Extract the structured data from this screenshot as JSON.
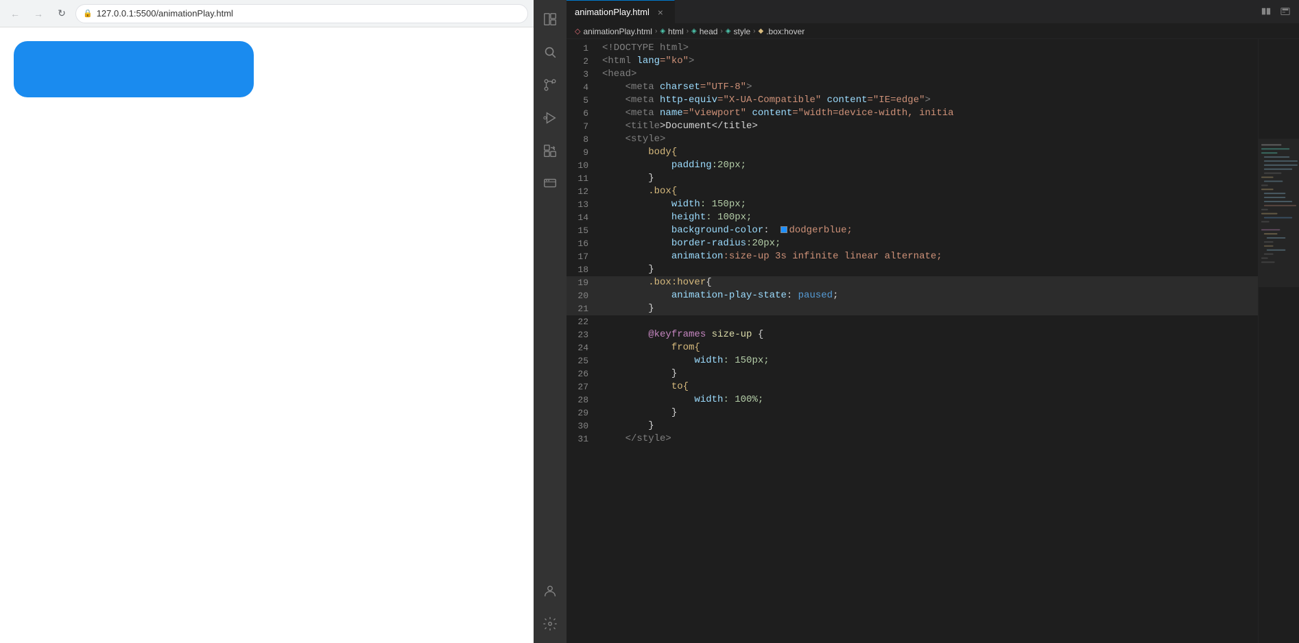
{
  "browser": {
    "url": "127.0.0.1:5500/animationPlay.html",
    "back_disabled": true,
    "forward_disabled": true
  },
  "vscode": {
    "tab": {
      "filename": "animationPlay.html",
      "close_symbol": "×"
    },
    "tab_actions": [
      "⊡",
      "⊞"
    ],
    "breadcrumb": {
      "items": [
        {
          "label": "animationPlay.html",
          "icon": "◇"
        },
        {
          "label": "html",
          "icon": "◈"
        },
        {
          "label": "head",
          "icon": "◈"
        },
        {
          "label": "style",
          "icon": "◈"
        },
        {
          "label": ".box:hover",
          "icon": "◆"
        }
      ]
    },
    "lines": [
      {
        "num": 1,
        "tokens": [
          {
            "t": "<!DOCTYPE html>",
            "c": "kw-doctype"
          }
        ]
      },
      {
        "num": 2,
        "tokens": [
          {
            "t": "<html",
            "c": "tag-bracket"
          },
          {
            "t": " lang",
            "c": "attr-name"
          },
          {
            "t": "=\"ko\"",
            "c": "attr-value"
          },
          {
            "t": ">",
            "c": "tag-bracket"
          }
        ]
      },
      {
        "num": 3,
        "tokens": [
          {
            "t": "<head>",
            "c": "tag-bracket"
          }
        ]
      },
      {
        "num": 4,
        "tokens": [
          {
            "t": "    ",
            "c": ""
          },
          {
            "t": "<meta",
            "c": "tag-bracket"
          },
          {
            "t": " charset",
            "c": "attr-name"
          },
          {
            "t": "=\"UTF-8\"",
            "c": "attr-value"
          },
          {
            "t": ">",
            "c": "tag-bracket"
          }
        ]
      },
      {
        "num": 5,
        "tokens": [
          {
            "t": "    ",
            "c": ""
          },
          {
            "t": "<meta",
            "c": "tag-bracket"
          },
          {
            "t": " http-equiv",
            "c": "attr-name"
          },
          {
            "t": "=\"X-UA-Compatible\"",
            "c": "attr-value"
          },
          {
            "t": " content",
            "c": "attr-name"
          },
          {
            "t": "=\"IE=edge\"",
            "c": "attr-value"
          },
          {
            "t": ">",
            "c": "tag-bracket"
          }
        ]
      },
      {
        "num": 6,
        "tokens": [
          {
            "t": "    ",
            "c": ""
          },
          {
            "t": "<meta",
            "c": "tag-bracket"
          },
          {
            "t": " name",
            "c": "attr-name"
          },
          {
            "t": "=\"viewport\"",
            "c": "attr-value"
          },
          {
            "t": " content",
            "c": "attr-name"
          },
          {
            "t": "=\"width=device-width, initia",
            "c": "attr-value"
          }
        ]
      },
      {
        "num": 7,
        "tokens": [
          {
            "t": "    ",
            "c": ""
          },
          {
            "t": "<title",
            "c": "tag-bracket"
          },
          {
            "t": ">Document</title>",
            "c": "punct"
          }
        ]
      },
      {
        "num": 8,
        "tokens": [
          {
            "t": "    ",
            "c": ""
          },
          {
            "t": "<style>",
            "c": "tag-bracket"
          }
        ]
      },
      {
        "num": 9,
        "tokens": [
          {
            "t": "        body{",
            "c": "kw-selector"
          }
        ]
      },
      {
        "num": 10,
        "tokens": [
          {
            "t": "            padding",
            "c": "kw-property"
          },
          {
            "t": ":20px;",
            "c": "kw-value-num"
          }
        ]
      },
      {
        "num": 11,
        "tokens": [
          {
            "t": "        }",
            "c": "punct"
          }
        ]
      },
      {
        "num": 12,
        "tokens": [
          {
            "t": "        .box{",
            "c": "kw-selector"
          }
        ]
      },
      {
        "num": 13,
        "tokens": [
          {
            "t": "            width",
            "c": "kw-property"
          },
          {
            "t": ": 150px;",
            "c": "kw-value-num"
          }
        ]
      },
      {
        "num": 14,
        "tokens": [
          {
            "t": "            height",
            "c": "kw-property"
          },
          {
            "t": ": 100px;",
            "c": "kw-value-num"
          }
        ]
      },
      {
        "num": 15,
        "tokens": [
          {
            "t": "            background-color",
            "c": "kw-property"
          },
          {
            "t": ":  ",
            "c": "punct"
          },
          {
            "t": "SWATCH",
            "c": "swatch"
          },
          {
            "t": "dodgerblue;",
            "c": "kw-value"
          }
        ]
      },
      {
        "num": 16,
        "tokens": [
          {
            "t": "            border-radius",
            "c": "kw-property"
          },
          {
            "t": ":20px;",
            "c": "kw-value-num"
          }
        ]
      },
      {
        "num": 17,
        "tokens": [
          {
            "t": "            animation",
            "c": "kw-property"
          },
          {
            "t": ":size-up 3s infinite linear alternate;",
            "c": "kw-value"
          }
        ]
      },
      {
        "num": 18,
        "tokens": [
          {
            "t": "        }",
            "c": "punct"
          }
        ]
      },
      {
        "num": 19,
        "tokens": [
          {
            "t": "        .box:hover",
            "c": "kw-selector"
          },
          {
            "t": "{",
            "c": "punct"
          }
        ]
      },
      {
        "num": 20,
        "tokens": [
          {
            "t": "            animation-play-state",
            "c": "kw-property"
          },
          {
            "t": ": ",
            "c": "punct"
          },
          {
            "t": "paused",
            "c": "kw-paused"
          },
          {
            "t": ";",
            "c": "punct"
          }
        ]
      },
      {
        "num": 21,
        "tokens": [
          {
            "t": "        }",
            "c": "punct"
          }
        ]
      },
      {
        "num": 22,
        "tokens": []
      },
      {
        "num": 23,
        "tokens": [
          {
            "t": "        @keyframes",
            "c": "kw-at"
          },
          {
            "t": " size-up",
            "c": "kw-anim-name"
          },
          {
            "t": " {",
            "c": "punct"
          }
        ]
      },
      {
        "num": 24,
        "tokens": [
          {
            "t": "            from{",
            "c": "kw-selector"
          }
        ]
      },
      {
        "num": 25,
        "tokens": [
          {
            "t": "                width",
            "c": "kw-property"
          },
          {
            "t": ": 150px;",
            "c": "kw-value-num"
          }
        ]
      },
      {
        "num": 26,
        "tokens": [
          {
            "t": "            }",
            "c": "punct"
          }
        ]
      },
      {
        "num": 27,
        "tokens": [
          {
            "t": "            to{",
            "c": "kw-selector"
          }
        ]
      },
      {
        "num": 28,
        "tokens": [
          {
            "t": "                width",
            "c": "kw-property"
          },
          {
            "t": ": 100%;",
            "c": "kw-value-num"
          }
        ]
      },
      {
        "num": 29,
        "tokens": [
          {
            "t": "            }",
            "c": "punct"
          }
        ]
      },
      {
        "num": 30,
        "tokens": [
          {
            "t": "        }",
            "c": "punct"
          }
        ]
      },
      {
        "num": 31,
        "tokens": [
          {
            "t": "    ",
            "c": ""
          },
          {
            "t": "</style>",
            "c": "tag-bracket"
          }
        ]
      }
    ]
  },
  "icons": {
    "back": "←",
    "forward": "→",
    "refresh": "↻",
    "lock": "🔒",
    "explorer": "⊞",
    "search": "🔍",
    "source_control": "⑂",
    "run": "▶",
    "extensions": "⊟",
    "remote": "⊡",
    "account": "👤",
    "settings": "⚙"
  }
}
